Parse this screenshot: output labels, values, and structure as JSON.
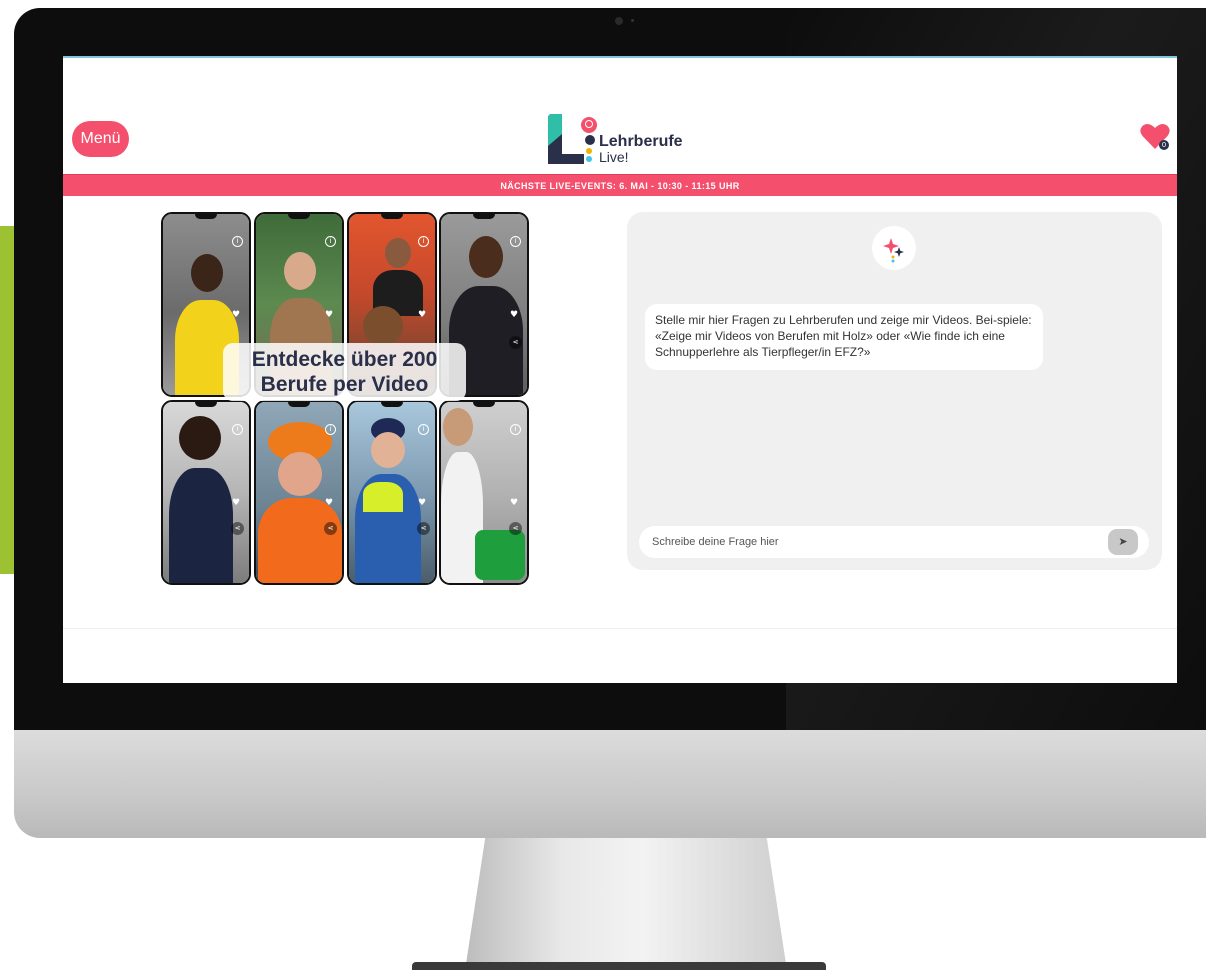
{
  "header": {
    "menu_label": "Menü",
    "logo_title": "Lehrberufe",
    "logo_subtitle": "Live!",
    "favorites_count": "0"
  },
  "event_banner": {
    "text": "NÄCHSTE LIVE-EVENTS:  6. MAI - 10:30 - 11:15 UHR"
  },
  "collage": {
    "caption_line1": "Entdecke über 200",
    "caption_line2": "Berufe per Video",
    "icons": [
      "info-icon",
      "heart-icon",
      "share-icon"
    ]
  },
  "chat": {
    "welcome_message": "Stelle mir hier Fragen zu Lehrberufen und zeige mir Videos. Bei-spiele: «Zeige mir Videos von Berufen mit Holz» oder «Wie finde ich eine Schnupperlehre als Tierpfleger/in EFZ?»",
    "input_placeholder": "Schreibe deine Frage hier",
    "send_symbol": "➤"
  },
  "colors": {
    "accent": "#f4506d",
    "navy": "#2a2f4a",
    "green_strip": "#9cc131",
    "chat_panel": "#f0f0f0"
  }
}
